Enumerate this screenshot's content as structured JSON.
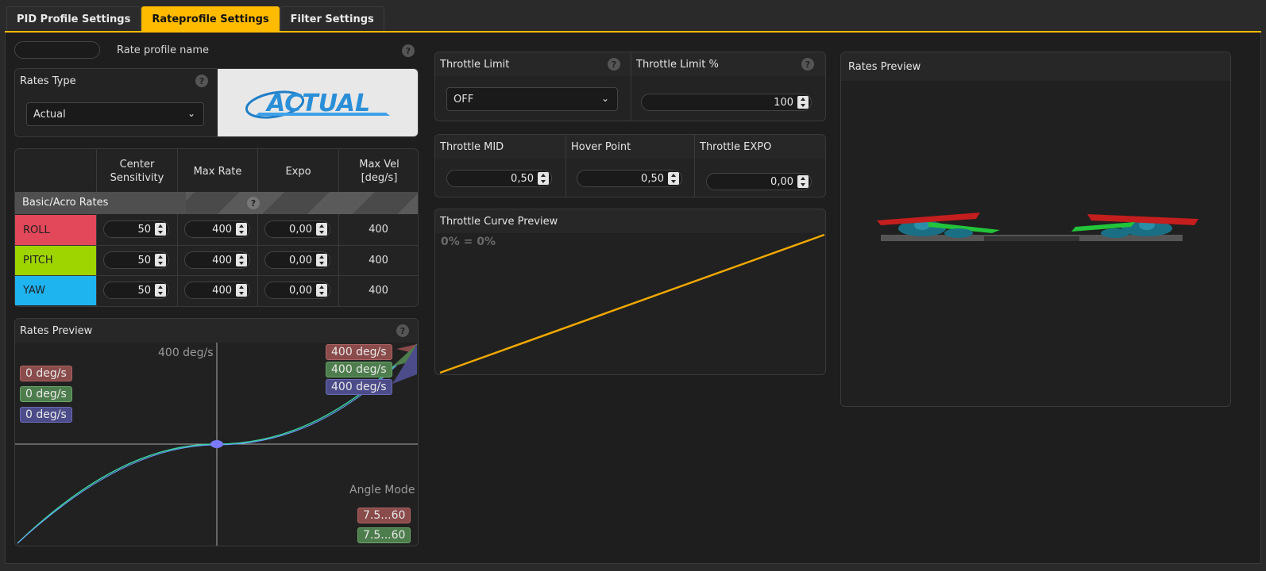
{
  "tabs": [
    {
      "label": "PID Profile Settings"
    },
    {
      "label": "Rateprofile Settings"
    },
    {
      "label": "Filter Settings"
    }
  ],
  "rate_profile_name": {
    "label": "Rate profile name",
    "value": ""
  },
  "rates_type": {
    "label": "Rates Type",
    "selected": "Actual",
    "logo_text": "ACTUAL"
  },
  "rates_table": {
    "headers": [
      "Center\nSensitivity",
      "Max Rate",
      "Expo",
      "Max Vel\n[deg/s]"
    ],
    "section": "Basic/Acro Rates",
    "rows": [
      {
        "axis": "ROLL",
        "color": "#e2475a",
        "center": "50",
        "max_rate": "400",
        "expo": "0,00",
        "max_vel": "400"
      },
      {
        "axis": "PITCH",
        "color": "#9ed400",
        "center": "50",
        "max_rate": "400",
        "expo": "0,00",
        "max_vel": "400"
      },
      {
        "axis": "YAW",
        "color": "#1eb4f0",
        "center": "50",
        "max_rate": "400",
        "expo": "0,00",
        "max_vel": "400"
      }
    ]
  },
  "rates_preview": {
    "title": "Rates Preview",
    "max_label": "400 deg/s",
    "current": [
      "0 deg/s",
      "0 deg/s",
      "0 deg/s"
    ],
    "max": [
      "400 deg/s",
      "400 deg/s",
      "400 deg/s"
    ],
    "angle_mode_label": "Angle Mode",
    "angle": [
      "7.5...60",
      "7.5...60"
    ]
  },
  "throttle_limit": {
    "label": "Throttle Limit",
    "selected": "OFF"
  },
  "throttle_limit_pct": {
    "label": "Throttle Limit %",
    "value": "100"
  },
  "throttle_mid": {
    "label": "Throttle MID",
    "value": "0,50"
  },
  "hover_point": {
    "label": "Hover Point",
    "value": "0,50"
  },
  "throttle_expo": {
    "label": "Throttle EXPO",
    "value": "0,00"
  },
  "throttle_curve": {
    "title": "Throttle Curve Preview",
    "readout": "0% = 0%"
  },
  "rates_preview_3d": {
    "title": "Rates Preview"
  },
  "colors": {
    "accent": "#ffbb00",
    "roll": "#e2475a",
    "pitch": "#9ed400",
    "yaw": "#1eb4f0",
    "curve": "#f0a800"
  }
}
